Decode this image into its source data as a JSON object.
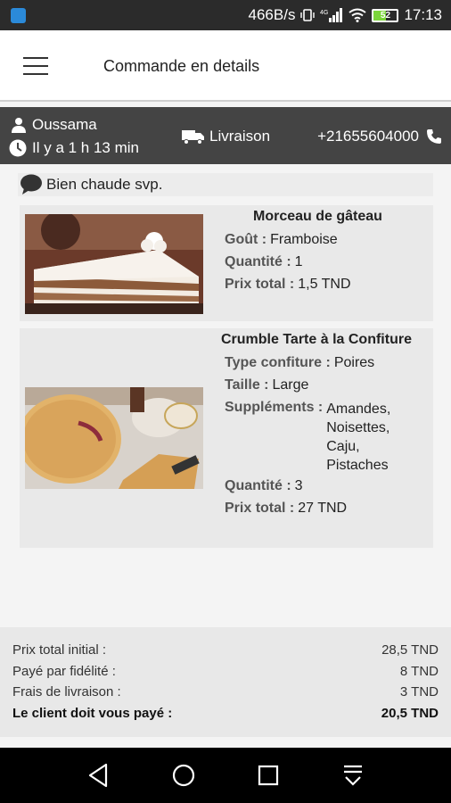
{
  "status": {
    "network": "466B/s",
    "battery": "52",
    "time": "17:13"
  },
  "appbar": {
    "title": "Commande en details"
  },
  "order": {
    "customer": "Oussama",
    "elapsed": "Il y a 1 h 13 min",
    "delivery": "Livraison",
    "phone": "+21655604000"
  },
  "note": "Bien chaude svp.",
  "items": [
    {
      "title": "Morceau de gâteau",
      "details": [
        {
          "label": "Goût :",
          "value": "Framboise"
        },
        {
          "label": "Quantité :",
          "value": "1"
        },
        {
          "label": "Prix total :",
          "value": "1,5 TND"
        }
      ]
    },
    {
      "title": "Crumble Tarte à la Confiture",
      "details": [
        {
          "label": "Type confiture :",
          "value": "Poires"
        },
        {
          "label": "Taille :",
          "value": "Large"
        },
        {
          "label": "Suppléments :",
          "value": "Amandes, Noisettes, Caju, Pistaches"
        },
        {
          "label": "Quantité :",
          "value": "3"
        },
        {
          "label": "Prix total :",
          "value": "27 TND"
        }
      ]
    }
  ],
  "totals": [
    {
      "label": "Prix total initial :",
      "value": "28,5 TND"
    },
    {
      "label": "Payé par fidélité :",
      "value": "8 TND"
    },
    {
      "label": "Frais de livraison :",
      "value": "3 TND"
    },
    {
      "label": "Le client doit vous payé :",
      "value": "20,5 TND"
    }
  ],
  "icons": {
    "menu": "menu-icon",
    "person": "person-icon",
    "clock": "clock-icon",
    "truck": "truck-icon",
    "phone": "phone-icon",
    "chat": "chat-bubble-icon",
    "nav_back": "back-icon",
    "nav_home": "home-icon",
    "nav_recent": "recents-icon",
    "nav_notif": "notification-pull-icon"
  }
}
